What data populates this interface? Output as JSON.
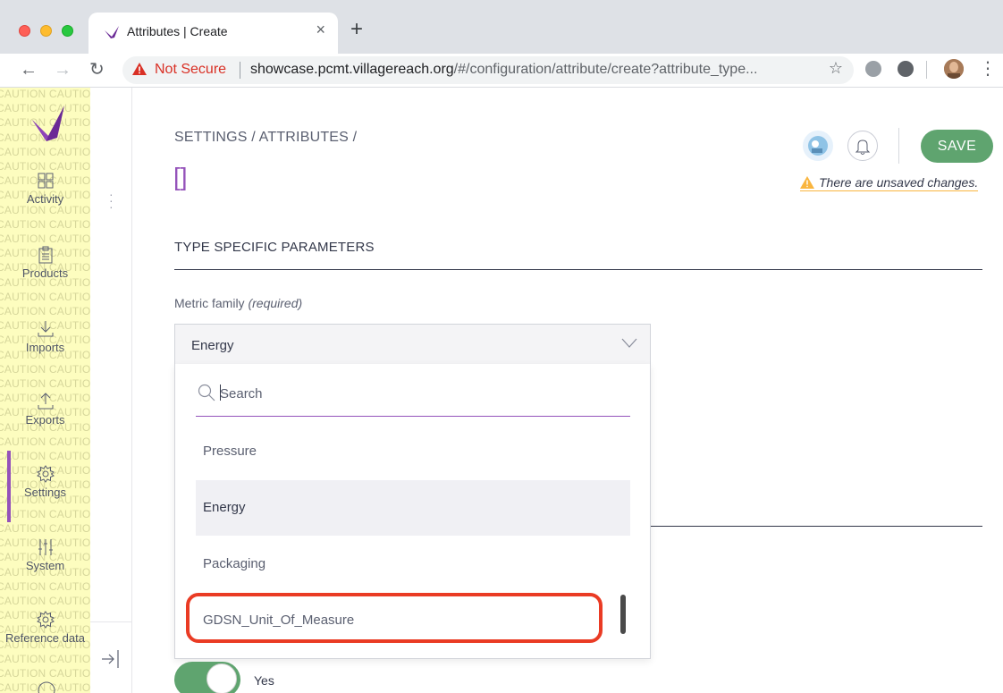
{
  "browser": {
    "tab_title": "Attributes | Create",
    "tab_close": "×",
    "new_tab": "+",
    "security_label": "Not Secure",
    "url_host": "showcase.pcmt.villagereach.org",
    "url_path": "/#/configuration/attribute/create?attribute_type..."
  },
  "sidebar": {
    "caution_text": "CAUTION CAUTION",
    "items": [
      {
        "label": "Activity",
        "icon": "activity-grid-icon"
      },
      {
        "label": "Products",
        "icon": "clipboard-icon"
      },
      {
        "label": "Imports",
        "icon": "import-icon"
      },
      {
        "label": "Exports",
        "icon": "export-icon"
      },
      {
        "label": "Settings",
        "icon": "gear-icon"
      },
      {
        "label": "System",
        "icon": "sliders-icon"
      },
      {
        "label": "Reference data",
        "icon": "gear-icon"
      }
    ],
    "active_item": "Settings"
  },
  "header": {
    "breadcrumb": "SETTINGS / ATTRIBUTES /",
    "title": "[]",
    "save_label": "SAVE",
    "unsaved_message": "There are unsaved changes."
  },
  "form": {
    "section_title": "TYPE SPECIFIC PARAMETERS",
    "metric_family_label": "Metric family",
    "metric_family_required": "(required)",
    "selected_value": "Energy",
    "search_placeholder": "Search",
    "options": [
      "Pressure",
      "Energy",
      "Packaging",
      "GDSN_Unit_Of_Measure"
    ],
    "toggle_label": "Yes",
    "toggle_on": true
  },
  "colors": {
    "accent": "#9452ba",
    "save_green": "#5fa46f",
    "highlight_red": "#ea3b24",
    "caution_yellow": "#fdfdbf"
  }
}
